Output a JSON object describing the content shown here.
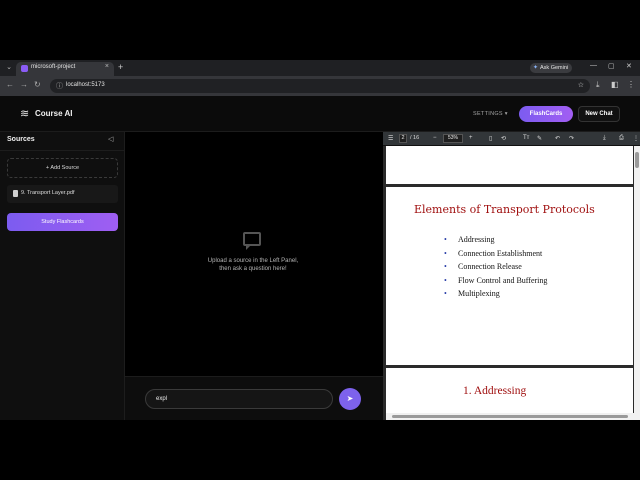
{
  "browser": {
    "tab_title": "microsoft-project",
    "tab_close": "×",
    "new_tab": "+",
    "gemini_label": "Ask Gemini",
    "url": "localhost:5173",
    "window_controls": [
      "—",
      "▢",
      "✕"
    ]
  },
  "header": {
    "app_name": "Course AI",
    "settings_label": "SETTINGS",
    "flashcards_label": "FlashCards",
    "new_chat_label": "New Chat"
  },
  "sidebar": {
    "title": "Sources",
    "add_source_label": "+ Add Source",
    "sources": [
      {
        "label": "9. Transport Layer.pdf"
      }
    ],
    "study_label": "Study Flashcards"
  },
  "chat": {
    "empty_line1": "Upload a source in the Left Panel,",
    "empty_line2": "then ask a question here!",
    "input_value": "expl"
  },
  "pdf": {
    "page_current": "2",
    "page_total": "/ 16",
    "zoom": "53%",
    "heading": "Elements of Transport Protocols",
    "bullets": [
      "Addressing",
      "Connection Establishment",
      "Connection Release",
      "Flow Control and Buffering",
      "Multiplexing"
    ],
    "next_heading": "1. Addressing"
  }
}
